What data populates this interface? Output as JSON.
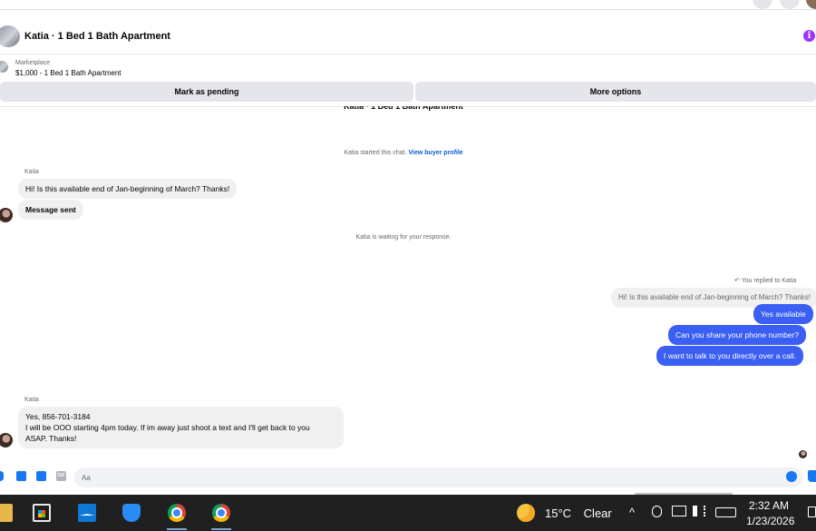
{
  "header": {
    "title": "Katia · 1 Bed 1 Bath Apartment",
    "info_icon": "i"
  },
  "listing": {
    "source": "Marketplace",
    "price_title": "$1,000 - 1 Bed 1 Bath Apartment"
  },
  "actions": {
    "mark_pending": "Mark as pending",
    "more_options": "More options"
  },
  "chat": {
    "cut_title": "Katia · 1 Bed 1 Bath Apartment",
    "started_text": "Katia started this chat.",
    "view_profile": "View buyer profile",
    "sender_1": "Katia",
    "msg_1": "Hi! Is this available end of Jan-beginning of March? Thanks!",
    "msg_2": "Message sent",
    "waiting_text": "Katia is waiting for your response.",
    "replied_label": "You replied to Katia",
    "quoted": "Hi! Is this available end of Jan-beginning of March? Thanks!",
    "out_1": "Yes available",
    "out_2": "Can you share your phone number?",
    "out_3": "I want to talk to you directly over a call.",
    "sender_2": "Katia",
    "msg_3_line1": "Yes, 856-701-3184",
    "msg_3_line2": "I will be OOO starting 4pm today. If im away just shoot a text and I'll get back to you",
    "msg_3_line3": "ASAP. Thanks!"
  },
  "composer": {
    "placeholder": "Aa",
    "gif_label": "GIF"
  },
  "taskbar": {
    "weather_temp": "15°C",
    "weather_cond": "Clear",
    "tray_chevron": "^",
    "time": "2:32 AM",
    "date": "1/23/2026",
    "icons": [
      "folder-icon",
      "store-icon",
      "mail-icon",
      "shield-icon",
      "chrome-icon",
      "chrome-icon"
    ]
  },
  "colors": {
    "outgoing_bubble": "#3a5ff2",
    "incoming_bubble": "#f0f0f0",
    "link": "#0a5bd8",
    "taskbar": "#202020",
    "info_icon": "#a033ff"
  }
}
